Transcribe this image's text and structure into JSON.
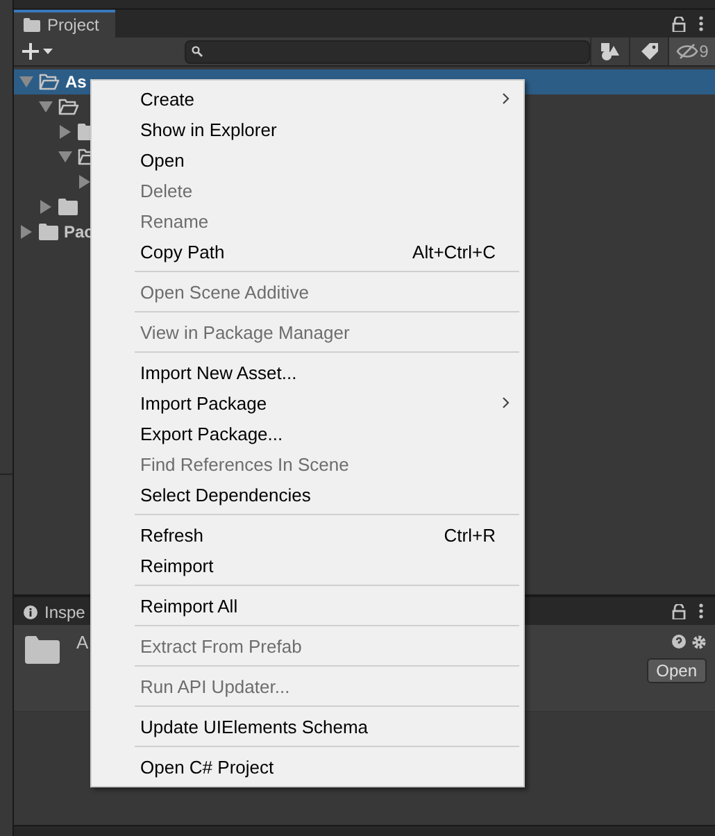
{
  "project_panel": {
    "tab": {
      "label": "Project",
      "selected": true
    },
    "hidden_count": "9",
    "tree": [
      {
        "label": "As",
        "selected": true,
        "expanded": true,
        "children": [
          {
            "selected": false,
            "expanded": true,
            "children": [
              {
                "selected": false,
                "expanded": false
              },
              {
                "selected": false,
                "expanded": true,
                "children": [
                  {
                    "selected": false,
                    "expanded": false
                  }
                ]
              }
            ]
          },
          {
            "selected": false,
            "expanded": false
          }
        ]
      },
      {
        "label": "Pac",
        "selected": false,
        "expanded": false
      }
    ]
  },
  "inspector_panel": {
    "tab": {
      "label": "Inspe",
      "selected": false
    },
    "title": "A",
    "open_button": "Open"
  },
  "context_menu": {
    "items": [
      {
        "kind": "item",
        "label": "Create",
        "submenu": true,
        "disabled": false
      },
      {
        "kind": "item",
        "label": "Show in Explorer",
        "submenu": false,
        "disabled": false
      },
      {
        "kind": "item",
        "label": "Open",
        "submenu": false,
        "disabled": false
      },
      {
        "kind": "item",
        "label": "Delete",
        "submenu": false,
        "disabled": true
      },
      {
        "kind": "item",
        "label": "Rename",
        "submenu": false,
        "disabled": true
      },
      {
        "kind": "item",
        "label": "Copy Path",
        "shortcut": "Alt+Ctrl+C",
        "submenu": false,
        "disabled": false
      },
      {
        "kind": "separator"
      },
      {
        "kind": "item",
        "label": "Open Scene Additive",
        "submenu": false,
        "disabled": true
      },
      {
        "kind": "separator"
      },
      {
        "kind": "item",
        "label": "View in Package Manager",
        "submenu": false,
        "disabled": true
      },
      {
        "kind": "separator"
      },
      {
        "kind": "item",
        "label": "Import New Asset...",
        "submenu": false,
        "disabled": false
      },
      {
        "kind": "item",
        "label": "Import Package",
        "submenu": true,
        "disabled": false
      },
      {
        "kind": "item",
        "label": "Export Package...",
        "submenu": false,
        "disabled": false
      },
      {
        "kind": "item",
        "label": "Find References In Scene",
        "submenu": false,
        "disabled": true
      },
      {
        "kind": "item",
        "label": "Select Dependencies",
        "submenu": false,
        "disabled": false
      },
      {
        "kind": "separator"
      },
      {
        "kind": "item",
        "label": "Refresh",
        "shortcut": "Ctrl+R",
        "submenu": false,
        "disabled": false
      },
      {
        "kind": "item",
        "label": "Reimport",
        "submenu": false,
        "disabled": false
      },
      {
        "kind": "separator"
      },
      {
        "kind": "item",
        "label": "Reimport All",
        "submenu": false,
        "disabled": false
      },
      {
        "kind": "separator"
      },
      {
        "kind": "item",
        "label": "Extract From Prefab",
        "submenu": false,
        "disabled": true
      },
      {
        "kind": "separator"
      },
      {
        "kind": "item",
        "label": "Run API Updater...",
        "submenu": false,
        "disabled": true
      },
      {
        "kind": "separator"
      },
      {
        "kind": "item",
        "label": "Update UIElements Schema",
        "submenu": false,
        "disabled": false
      },
      {
        "kind": "separator"
      },
      {
        "kind": "item",
        "label": "Open C# Project",
        "submenu": false,
        "disabled": false
      }
    ]
  }
}
